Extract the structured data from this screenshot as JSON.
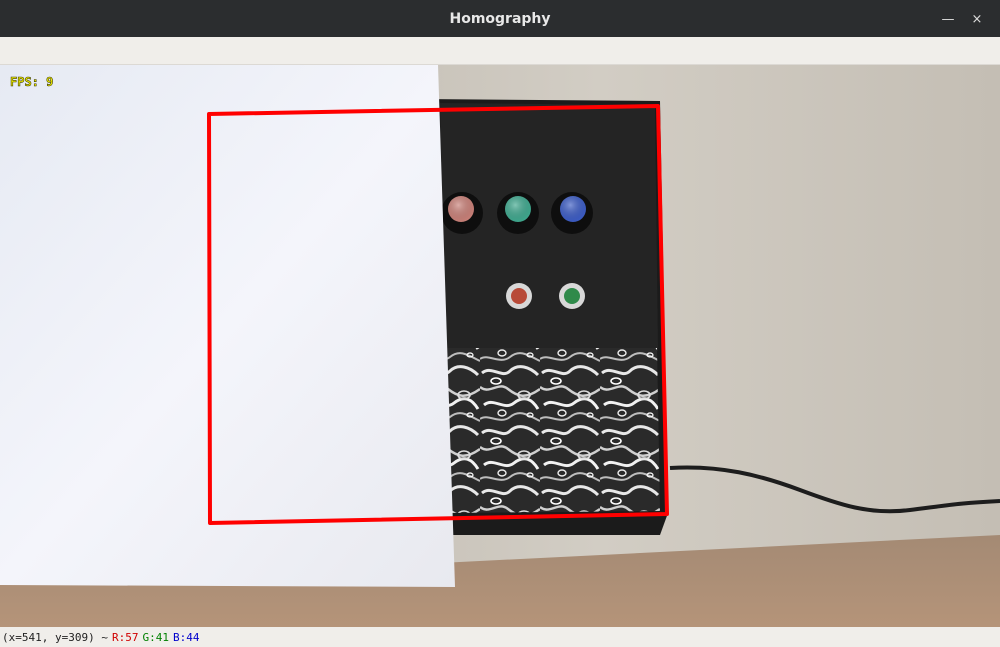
{
  "window": {
    "title": "Homography",
    "minimize_glyph": "—",
    "close_glyph": "×"
  },
  "overlay": {
    "fps_text": "FPS: 9"
  },
  "status": {
    "coords": "(x=541, y=309) ~",
    "r": "R:57",
    "g": "G:41",
    "b": "B:44"
  },
  "colors": {
    "roi_outline": "#ff0000",
    "fps_text": "#f5f000"
  },
  "knobs": [
    {
      "name": "knob-red",
      "color": "#c98078"
    },
    {
      "name": "knob-green",
      "color": "#3fa88e"
    },
    {
      "name": "knob-blue",
      "color": "#3c5cc4"
    }
  ],
  "buttons": [
    {
      "name": "button-red",
      "color": "#b84a38"
    },
    {
      "name": "button-green",
      "color": "#2f8a4a"
    }
  ]
}
